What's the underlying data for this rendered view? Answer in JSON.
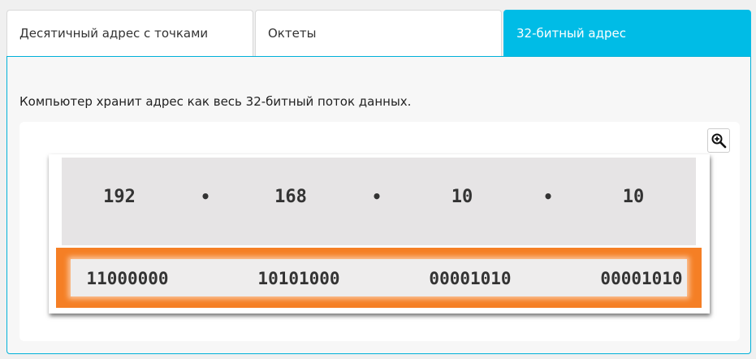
{
  "tabs": [
    {
      "label": "Десятичный адрес с точками",
      "active": false
    },
    {
      "label": "Октеты",
      "active": false
    },
    {
      "label": "32-битный адрес",
      "active": true
    }
  ],
  "content": {
    "description": "Компьютер хранит адрес как весь 32-битный поток данных.",
    "zoom_icon": "zoom-in-icon",
    "decimal_octets": [
      "192",
      "168",
      "10",
      "10"
    ],
    "separator": "•",
    "binary_octets": [
      "11000000",
      "10101000",
      "00001010",
      "00001010"
    ]
  },
  "colors": {
    "active_tab": "#00bce6",
    "highlight_frame": "#f57f25",
    "decimal_background": "#e6e4e5"
  }
}
